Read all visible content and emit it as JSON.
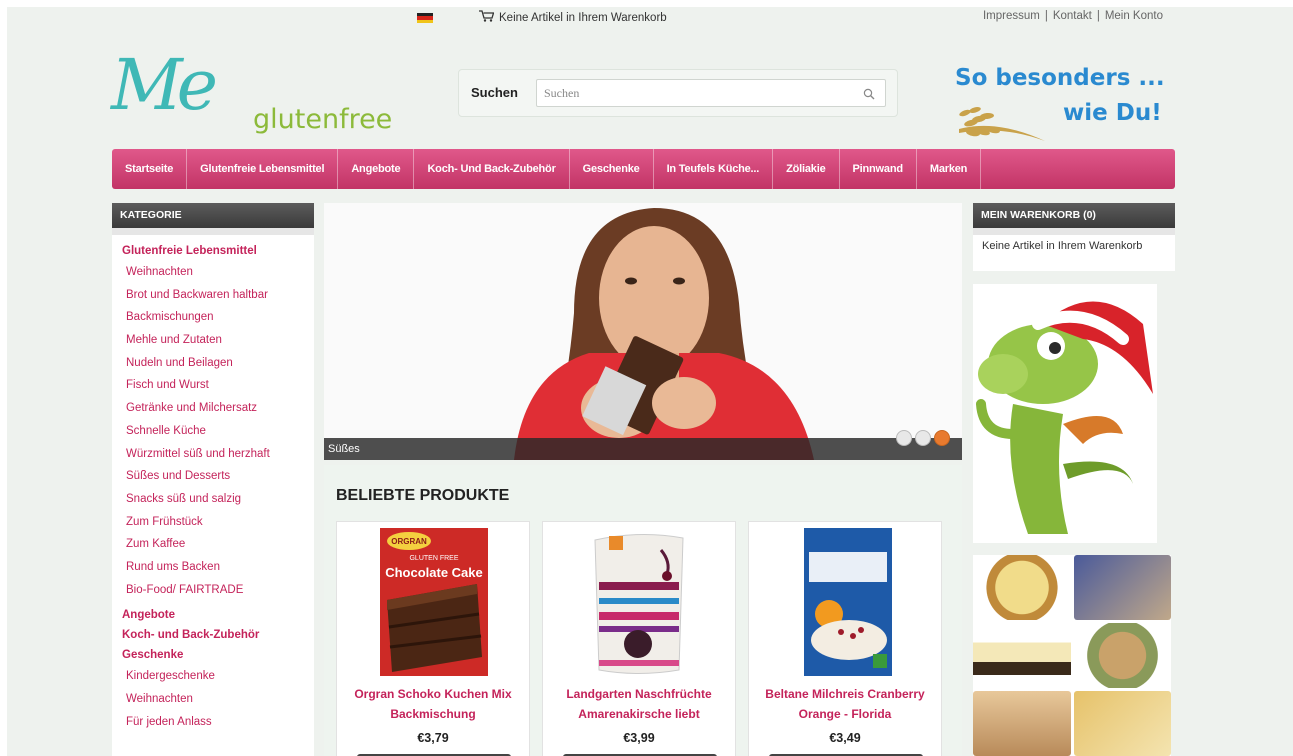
{
  "topbar": {
    "cart_status": "Keine Artikel in Ihrem Warenkorb",
    "links": [
      "Impressum",
      "Kontakt",
      "Mein Konto"
    ],
    "separator": "|"
  },
  "logo": {
    "me": "Me",
    "glutenfree": "glutenfree"
  },
  "search": {
    "label": "Suchen",
    "placeholder": "Suchen"
  },
  "slogan": {
    "line1": "So besonders ...",
    "line2": "wie Du!"
  },
  "nav": {
    "items": [
      "Startseite",
      "Glutenfreie Lebensmittel",
      "Angebote",
      "Koch- Und Back-Zubehör",
      "Geschenke",
      "In Teufels Küche...",
      "Zöliakie",
      "Pinnwand",
      "Marken"
    ]
  },
  "categories": {
    "heading": "KATEGORIE",
    "main1": "Glutenfreie Lebensmittel",
    "sub1": [
      "Weihnachten",
      "Brot und Backwaren haltbar",
      "Backmischungen",
      "Mehle und Zutaten",
      "Nudeln und Beilagen",
      "Fisch und Wurst",
      "Getränke und Milchersatz",
      "Schnelle Küche",
      "Würzmittel süß und herzhaft",
      "Süßes und Desserts",
      "Snacks süß und salzig",
      "Zum Frühstück",
      "Zum Kaffee",
      "Rund ums Backen",
      "Bio-Food/ FAIRTRADE"
    ],
    "main2": "Angebote",
    "main3": "Koch- und Back-Zubehör",
    "main4": "Geschenke",
    "sub2": [
      "Kindergeschenke",
      "Weihnachten",
      "Für jeden Anlass"
    ]
  },
  "slider": {
    "caption": "Süßes",
    "dot_count": 3,
    "active_dot": 3
  },
  "products": {
    "heading": "BELIEBTE PRODUKTE",
    "items": [
      {
        "name": "Orgran Schoko Kuchen Mix Backmischung",
        "price": "€3,79",
        "pack_brand": "ORGRAN",
        "pack_text1": "GLUTEN FREE",
        "pack_text2": "Chocolate Cake"
      },
      {
        "name": "Landgarten Naschfrüchte Amarenakirsche liebt",
        "price": "€3,99"
      },
      {
        "name": "Beltane Milchreis Cranberry Orange - Florida",
        "price": "€3,49"
      }
    ]
  },
  "cart": {
    "heading": "MEIN WARENKORB (0)",
    "empty_text": "Keine Artikel in Ihrem Warenkorb"
  },
  "colors": {
    "nav": "#d1457a",
    "link": "#c4235a",
    "accent": "#e87a2e",
    "page_bg": "#eef2ee"
  },
  "icons": [
    "flag-germany-icon",
    "cart-icon",
    "search-icon"
  ]
}
